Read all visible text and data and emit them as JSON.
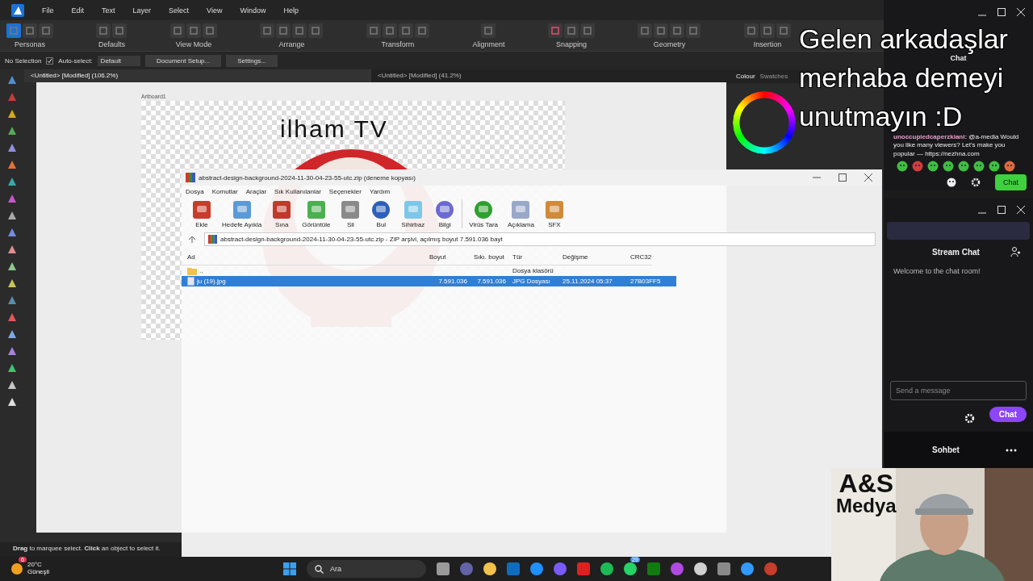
{
  "app": {
    "menu": [
      "File",
      "Edit",
      "Text",
      "Layer",
      "Select",
      "View",
      "Window",
      "Help"
    ],
    "toolbar_groups": [
      "Personas",
      "Defaults",
      "View Mode",
      "Arrange",
      "Transform",
      "Alignment",
      "Snapping",
      "Geometry",
      "Insertion"
    ],
    "context": {
      "selection": "No Selection",
      "autoselect_label": "Auto-select:",
      "autoselect_checked": true,
      "autoselect_value": "Default",
      "buttons": [
        "Document Setup...",
        "Settings..."
      ]
    },
    "doc_tabs": [
      {
        "title": "<Untitled> [Modified] (106.2%)",
        "selected": true
      },
      {
        "title": "<Untitled> [Modified] (41.2%)",
        "selected": false
      }
    ],
    "artboard": {
      "label": "Artboard1",
      "title": "ilham TV"
    },
    "panel_tabs": [
      {
        "label": "Colour",
        "selected": true
      },
      {
        "label": "Swatches",
        "selected": false
      }
    ],
    "status": "**Drag** to marquee select. **Click** an object to select it."
  },
  "archive_window": {
    "title": "abstract-design-background-2024-11-30-04-23-55-utc.zip (deneme kopyası)",
    "menu": [
      "Dosya",
      "Komutlar",
      "Araçlar",
      "Sık Kullanılanlar",
      "Seçenekler",
      "Yardım"
    ],
    "tools": [
      "Ekle",
      "Hedefe Ayıkla",
      "Sına",
      "Görüntüle",
      "Sil",
      "Bul",
      "Sihirbaz",
      "Bilgi",
      "Virüs Tara",
      "Açıklama",
      "SFX"
    ],
    "path": "abstract-design-background-2024-11-30-04-23-55-utc.zip - ZIP arşivi, açılmış boyut 7.591.036 bayt",
    "columns": [
      "Ad",
      "Boyut",
      "Sıkı. boyut",
      "Tür",
      "Değişme",
      "CRC32"
    ],
    "rows": [
      {
        "kind": "folder",
        "name": "..",
        "type": "Dosya klasörü",
        "selected": false
      },
      {
        "kind": "file",
        "name": "ju (19).jpg",
        "size": "7.591.036",
        "packed": "7.591.036",
        "type": "JPG Dosyası",
        "modified": "25.11.2024 05:37",
        "crc": "27B03FF5",
        "selected": true
      }
    ]
  },
  "chat_window": {
    "title": "Chat",
    "user": "unoccupiedcaperzkiani:",
    "message": "@a-media Would you like many viewers? Let's make you popular — https://nezhna.com",
    "button": "Chat"
  },
  "stream_chat": {
    "title": "Stream Chat",
    "welcome": "Welcome to the chat room!",
    "placeholder": "Send a message",
    "button": "Chat"
  },
  "sidebar_bar": {
    "title": "Sohbet"
  },
  "caption": [
    "Gelen arkadaşlar",
    "merhaba demeyi",
    "unutmayın :D"
  ],
  "logo": {
    "mark": "A&S",
    "name": "Medya"
  },
  "taskbar": {
    "temperature": "20°C",
    "weather": "Güneşli",
    "weather_badge": "6",
    "search_placeholder": "Ara",
    "apps": [
      {
        "color": "#9a9a9a"
      },
      {
        "color": "#6264a7"
      },
      {
        "color": "#f2c14e"
      },
      {
        "color": "#0f6cbd"
      },
      {
        "color": "#1e90ff"
      },
      {
        "color": "#7a5af8"
      },
      {
        "color": "#e02020"
      },
      {
        "color": "#1db954"
      },
      {
        "color": "#25d366",
        "badge": "29"
      },
      {
        "color": "#107c10"
      },
      {
        "color": "#b04ae0"
      },
      {
        "color": "#d0d0d0"
      },
      {
        "color": "#8a8a8a"
      },
      {
        "color": "#2f9bff"
      },
      {
        "color": "#c83c2c"
      }
    ]
  }
}
